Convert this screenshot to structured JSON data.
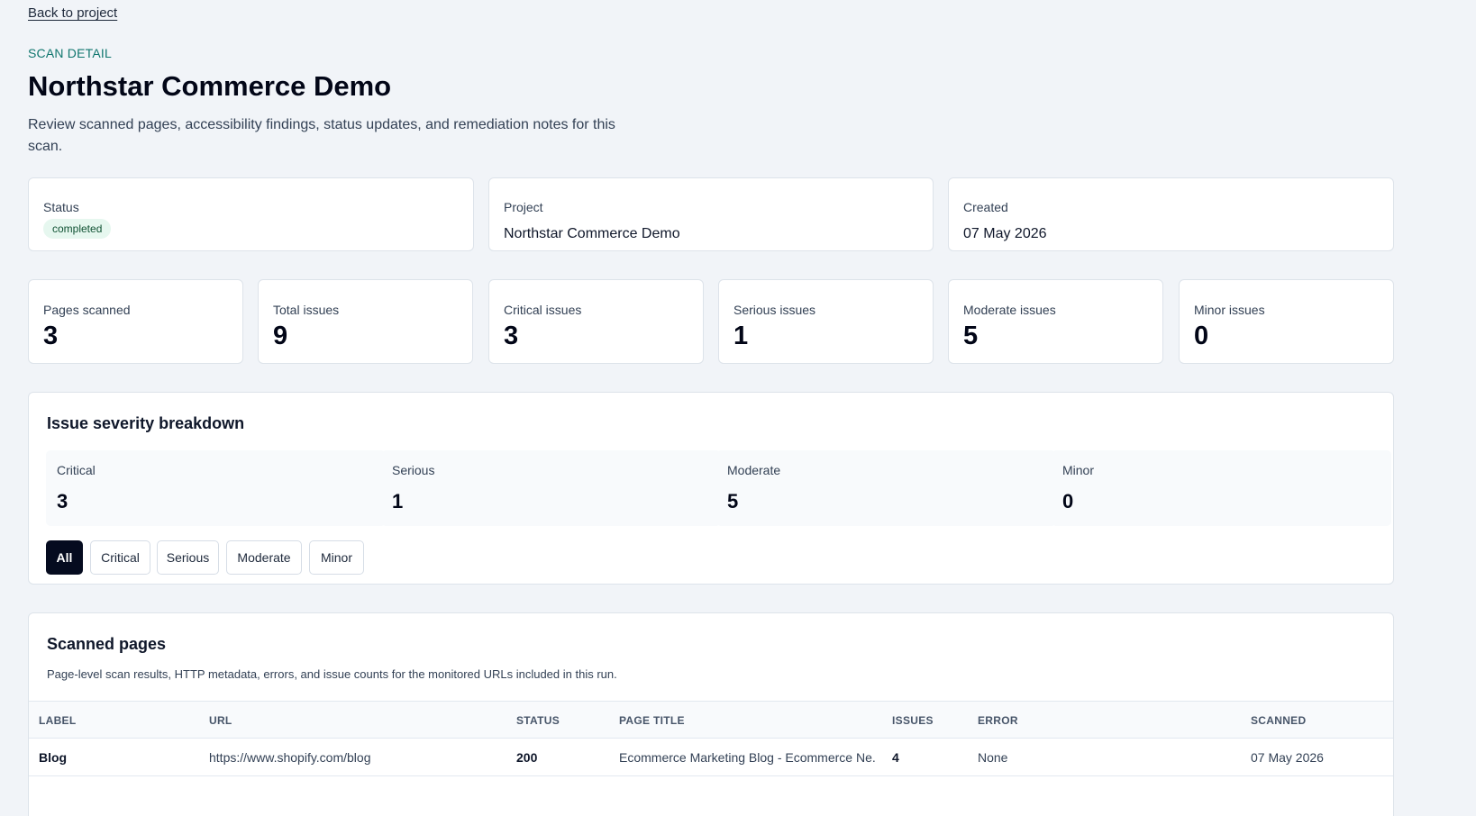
{
  "nav": {
    "back_link": "Back to project"
  },
  "header": {
    "eyebrow": "SCAN DETAIL",
    "title": "Northstar Commerce Demo",
    "description": "Review scanned pages, accessibility findings, status updates, and remediation notes for this scan."
  },
  "meta": {
    "status_label": "Status",
    "status_value": "completed",
    "project_label": "Project",
    "project_value": "Northstar Commerce Demo",
    "created_label": "Created",
    "created_value": "07 May 2026"
  },
  "stats": [
    {
      "label": "Pages scanned",
      "value": "3"
    },
    {
      "label": "Total issues",
      "value": "9"
    },
    {
      "label": "Critical issues",
      "value": "3"
    },
    {
      "label": "Serious issues",
      "value": "1"
    },
    {
      "label": "Moderate issues",
      "value": "5"
    },
    {
      "label": "Minor issues",
      "value": "0"
    }
  ],
  "breakdown": {
    "title": "Issue severity breakdown",
    "items": [
      {
        "label": "Critical",
        "value": "3"
      },
      {
        "label": "Serious",
        "value": "1"
      },
      {
        "label": "Moderate",
        "value": "5"
      },
      {
        "label": "Minor",
        "value": "0"
      }
    ],
    "filters": [
      "All",
      "Critical",
      "Serious",
      "Moderate",
      "Minor"
    ],
    "active_filter": "All"
  },
  "pages_table": {
    "title": "Scanned pages",
    "subtitle": "Page-level scan results, HTTP metadata, errors, and issue counts for the monitored URLs included in this run.",
    "columns": [
      "LABEL",
      "URL",
      "STATUS",
      "PAGE TITLE",
      "ISSUES",
      "ERROR",
      "SCANNED"
    ],
    "rows": [
      {
        "label": "Blog",
        "url": "https://www.shopify.com/blog",
        "status": "200",
        "page_title": "Ecommerce Marketing Blog - Ecommerce Ne...",
        "issues": "4",
        "error": "None",
        "scanned": "07 May 2026"
      }
    ]
  },
  "colors": {
    "background": "#f1f4f8",
    "accent_teal": "#0f766e",
    "active_filter_bg": "#050b1f",
    "badge_bg": "#e6f7ef"
  }
}
